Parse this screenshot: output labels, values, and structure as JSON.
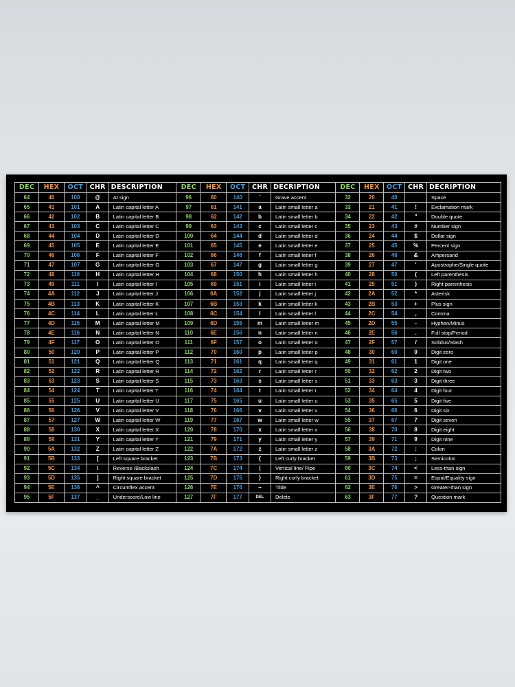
{
  "headers": {
    "group1": {
      "dec": "DEC",
      "hex": "HEX",
      "oct": "OCT",
      "chr": "CHR",
      "desc": "DESCRIPTION"
    },
    "group2": {
      "dec": "DEC",
      "hex": "HEX",
      "oct": "OCT",
      "chr": "CHR",
      "desc": "DECRIPTION"
    },
    "group3": {
      "dec": "DEC",
      "hex": "HEX",
      "oct": "OCT",
      "chr": "CHR",
      "desc": "DECRIPTION"
    }
  },
  "colors": {
    "dec": "#8fd06a",
    "hex": "#f0924a",
    "oct": "#4b9ad8",
    "text": "#ffffff",
    "background": "#000000"
  },
  "rows": [
    [
      [
        "64",
        "40",
        "100",
        "@",
        "At sign"
      ],
      [
        "96",
        "60",
        "140",
        "`",
        "Grave accent"
      ],
      [
        "32",
        "20",
        "40",
        "",
        "Space"
      ]
    ],
    [
      [
        "65",
        "41",
        "101",
        "A",
        "Latin capital letter A"
      ],
      [
        "97",
        "61",
        "141",
        "a",
        "Latin small letter a"
      ],
      [
        "33",
        "21",
        "41",
        "!",
        "Exclamation mark"
      ]
    ],
    [
      [
        "66",
        "42",
        "102",
        "B",
        "Latin capital letter B"
      ],
      [
        "98",
        "62",
        "142",
        "b",
        "Latin small letter b"
      ],
      [
        "34",
        "22",
        "42",
        "\"",
        "Double quote"
      ]
    ],
    [
      [
        "67",
        "43",
        "103",
        "C",
        "Latin capital letter C"
      ],
      [
        "99",
        "63",
        "143",
        "c",
        "Latin small letter c"
      ],
      [
        "35",
        "23",
        "43",
        "#",
        "Number sign"
      ]
    ],
    [
      [
        "68",
        "44",
        "104",
        "D",
        "Latin capital letter D"
      ],
      [
        "100",
        "64",
        "144",
        "d",
        "Latin small letter d"
      ],
      [
        "36",
        "24",
        "44",
        "$",
        "Dollar sign"
      ]
    ],
    [
      [
        "69",
        "45",
        "105",
        "E",
        "Latin capital letter E"
      ],
      [
        "101",
        "65",
        "145",
        "e",
        "Latin small letter e"
      ],
      [
        "37",
        "25",
        "45",
        "%",
        "Percent sign"
      ]
    ],
    [
      [
        "70",
        "46",
        "106",
        "F",
        "Latin capital letter F"
      ],
      [
        "102",
        "66",
        "146",
        "f",
        "Latin small letter f"
      ],
      [
        "38",
        "26",
        "46",
        "&",
        "Ampersand"
      ]
    ],
    [
      [
        "71",
        "47",
        "107",
        "G",
        "Latin capital letter G"
      ],
      [
        "103",
        "67",
        "147",
        "g",
        "Latin small letter g"
      ],
      [
        "39",
        "27",
        "47",
        "'",
        "Apostrophe/Single quote"
      ]
    ],
    [
      [
        "72",
        "48",
        "110",
        "H",
        "Latin capital letter H"
      ],
      [
        "104",
        "68",
        "150",
        "h",
        "Latin small letter h"
      ],
      [
        "40",
        "28",
        "50",
        "(",
        "Left parenthesis"
      ]
    ],
    [
      [
        "73",
        "49",
        "111",
        "I",
        "Latin capital letter I"
      ],
      [
        "105",
        "69",
        "151",
        "i",
        "Latin small letter i"
      ],
      [
        "41",
        "29",
        "51",
        ")",
        "Right parenthesis"
      ]
    ],
    [
      [
        "74",
        "4A",
        "112",
        "J",
        "Latin capital letter J"
      ],
      [
        "106",
        "6A",
        "152",
        "j",
        "Latin small letter j"
      ],
      [
        "42",
        "2A",
        "52",
        "*",
        "Asterisk"
      ]
    ],
    [
      [
        "75",
        "4B",
        "113",
        "K",
        "Latin capital letter K"
      ],
      [
        "107",
        "6B",
        "153",
        "k",
        "Latin small letter k"
      ],
      [
        "43",
        "2B",
        "53",
        "+",
        "Plus sign"
      ]
    ],
    [
      [
        "76",
        "4C",
        "114",
        "L",
        "Latin capital letter L"
      ],
      [
        "108",
        "6C",
        "154",
        "l",
        "Latin small letter l"
      ],
      [
        "44",
        "2C",
        "54",
        ",",
        "Comma"
      ]
    ],
    [
      [
        "77",
        "4D",
        "115",
        "M",
        "Latin capital letter M"
      ],
      [
        "109",
        "6D",
        "155",
        "m",
        "Latin small letter m"
      ],
      [
        "45",
        "2D",
        "55",
        "-",
        "Hyphen/Minus"
      ]
    ],
    [
      [
        "78",
        "4E",
        "116",
        "N",
        "Latin capital letter N"
      ],
      [
        "110",
        "6E",
        "156",
        "n",
        "Latin small letter n"
      ],
      [
        "46",
        "2E",
        "56",
        ".",
        "Full stop/Period"
      ]
    ],
    [
      [
        "79",
        "4F",
        "117",
        "O",
        "Latin capital letter O"
      ],
      [
        "111",
        "6F",
        "157",
        "o",
        "Latin small letter o"
      ],
      [
        "47",
        "2F",
        "57",
        "/",
        "Solidus/Slash"
      ]
    ],
    [
      [
        "80",
        "50",
        "120",
        "P",
        "Latin capital letter P"
      ],
      [
        "112",
        "70",
        "160",
        "p",
        "Latin small letter p"
      ],
      [
        "48",
        "30",
        "60",
        "0",
        "Digit zero"
      ]
    ],
    [
      [
        "81",
        "51",
        "121",
        "Q",
        "Latin capital letter Q"
      ],
      [
        "113",
        "71",
        "161",
        "q",
        "Latin small letter q"
      ],
      [
        "49",
        "31",
        "61",
        "1",
        "Digit one"
      ]
    ],
    [
      [
        "82",
        "52",
        "122",
        "R",
        "Latin capital letter R"
      ],
      [
        "114",
        "72",
        "162",
        "r",
        "Latin small letter r"
      ],
      [
        "50",
        "32",
        "62",
        "2",
        "Digit two"
      ]
    ],
    [
      [
        "83",
        "53",
        "123",
        "S",
        "Latin capital letter S"
      ],
      [
        "115",
        "73",
        "163",
        "s",
        "Latin small letter s"
      ],
      [
        "51",
        "33",
        "63",
        "3",
        "Digit three"
      ]
    ],
    [
      [
        "84",
        "54",
        "124",
        "T",
        "Latin capital letter T"
      ],
      [
        "116",
        "74",
        "164",
        "t",
        "Latin small letter t"
      ],
      [
        "52",
        "34",
        "64",
        "4",
        "Digit four"
      ]
    ],
    [
      [
        "85",
        "55",
        "125",
        "U",
        "Latin capital letter U"
      ],
      [
        "117",
        "75",
        "165",
        "u",
        "Latin small letter u"
      ],
      [
        "53",
        "35",
        "65",
        "5",
        "Digit five"
      ]
    ],
    [
      [
        "86",
        "56",
        "126",
        "V",
        "Latin capital letter V"
      ],
      [
        "118",
        "76",
        "166",
        "v",
        "Latin small letter v"
      ],
      [
        "54",
        "36",
        "66",
        "6",
        "Digit six"
      ]
    ],
    [
      [
        "87",
        "57",
        "127",
        "W",
        "Latin capital letter W"
      ],
      [
        "119",
        "77",
        "167",
        "w",
        "Latin small letter w"
      ],
      [
        "55",
        "37",
        "67",
        "7",
        "Digit seven"
      ]
    ],
    [
      [
        "88",
        "58",
        "130",
        "X",
        "Latin capital letter X"
      ],
      [
        "120",
        "78",
        "170",
        "x",
        "Latin small letter x"
      ],
      [
        "56",
        "38",
        "70",
        "8",
        "Digit eight"
      ]
    ],
    [
      [
        "89",
        "59",
        "131",
        "Y",
        "Latin capital letter Y"
      ],
      [
        "121",
        "79",
        "171",
        "y",
        "Latin small letter y"
      ],
      [
        "57",
        "39",
        "71",
        "9",
        "Digit nine"
      ]
    ],
    [
      [
        "90",
        "5A",
        "132",
        "Z",
        "Latin capital letter Z"
      ],
      [
        "122",
        "7A",
        "172",
        "z",
        "Latin small letter z"
      ],
      [
        "58",
        "3A",
        "72",
        ":",
        "Colon"
      ]
    ],
    [
      [
        "91",
        "5B",
        "133",
        "[",
        "Left square bracket"
      ],
      [
        "123",
        "7B",
        "173",
        "{",
        "Left curly bracket"
      ],
      [
        "59",
        "3B",
        "73",
        ";",
        "Semicolon"
      ]
    ],
    [
      [
        "92",
        "5C",
        "134",
        "\\",
        "Reverse /Backslash"
      ],
      [
        "124",
        "7C",
        "174",
        "|",
        "Vertical line/ Pipe"
      ],
      [
        "60",
        "3C",
        "74",
        "<",
        "Less-than sign"
      ]
    ],
    [
      [
        "93",
        "5D",
        "135",
        "]",
        "Right square bracket"
      ],
      [
        "125",
        "7D",
        "175",
        "}",
        "Right curly bracket"
      ],
      [
        "61",
        "3D",
        "75",
        "=",
        "Equal/Equality sign"
      ]
    ],
    [
      [
        "94",
        "5E",
        "136",
        "^",
        "Circumflex accent"
      ],
      [
        "126",
        "7E",
        "176",
        "~",
        "Tilde"
      ],
      [
        "62",
        "3E",
        "76",
        ">",
        "Greater-than sign"
      ]
    ],
    [
      [
        "95",
        "5F",
        "137",
        "_",
        "Underscore/Low line"
      ],
      [
        "127",
        "7F",
        "177",
        "DEL",
        "Delete"
      ],
      [
        "63",
        "3F",
        "77",
        "?",
        "Question mark"
      ]
    ]
  ]
}
